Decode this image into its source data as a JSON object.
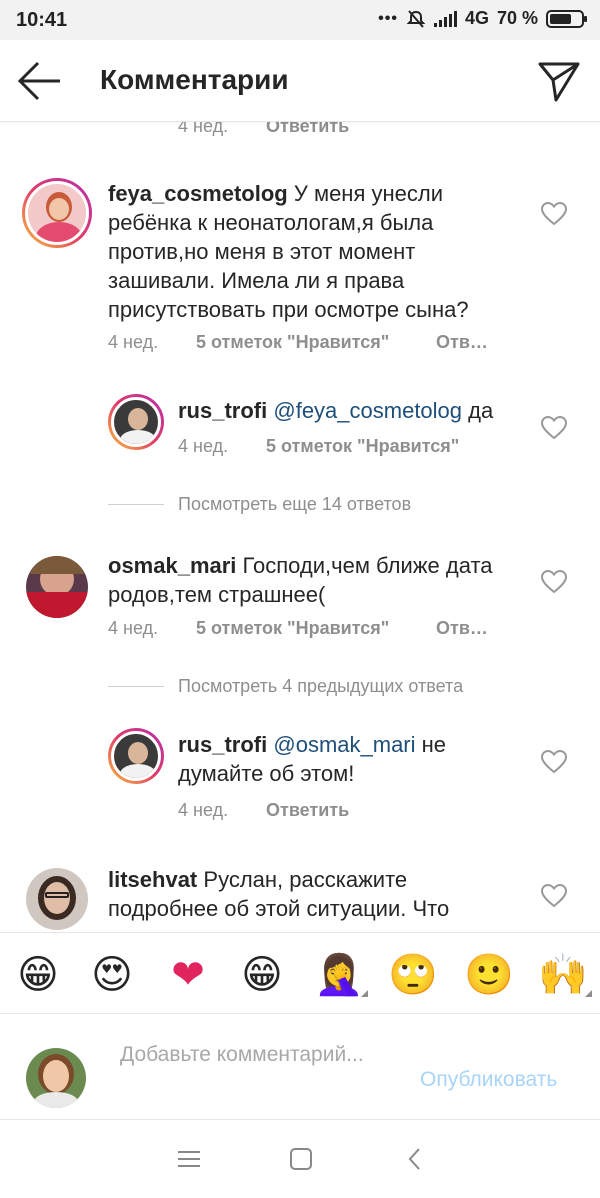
{
  "status_bar": {
    "time": "10:41",
    "network": "4G",
    "battery": "70 %",
    "battery_level": 0.7
  },
  "header": {
    "title": "Комментарии"
  },
  "top_partial": {
    "time": "4 нед.",
    "reply": "Ответить"
  },
  "comments": [
    {
      "username": "feya_cosmetolog",
      "text": "У меня унесли ребёнка к неонатологам,я была против,но меня в этот момент зашивали. Имела ли я права присутствовать при осмотре сына?",
      "time": "4 нед.",
      "likes": "5 отметок \"Нравится\"",
      "reply": "Отв…"
    },
    {
      "username": "rus_trofi",
      "mention": "@feya_cosmetolog",
      "text": "да",
      "time": "4 нед.",
      "likes": "5 отметок \"Нравится\""
    },
    {
      "username": "osmak_mari",
      "text": "Господи,чем ближе дата родов,тем страшнее(",
      "time": "4 нед.",
      "likes": "5 отметок \"Нравится\"",
      "reply": "Отв…"
    },
    {
      "username": "rus_trofi",
      "mention": "@osmak_mari",
      "text": "не думайте об этом!",
      "time": "4 нед.",
      "reply": "Ответить"
    },
    {
      "username": "litsehvat",
      "text": "Руслан, расскажите подробнее об этой ситуации. Что пытался сделать персонал роддом"
    }
  ],
  "view_more_1": "Посмотреть еще 14 ответов",
  "view_more_2": "Посмотреть 4 предыдущих ответа",
  "emoji_bar": [
    "😁",
    "😍",
    "❤",
    "😁",
    "🤦‍♀️",
    "🙄",
    "🙂",
    "🙌"
  ],
  "input": {
    "placeholder": "Добавьте комментарий...",
    "publish": "Опубликовать"
  },
  "colors": {
    "text": "#262626",
    "muted": "#8e8e8e",
    "mention": "#1e4f7a",
    "publish_disabled": "#a8d4f8"
  }
}
